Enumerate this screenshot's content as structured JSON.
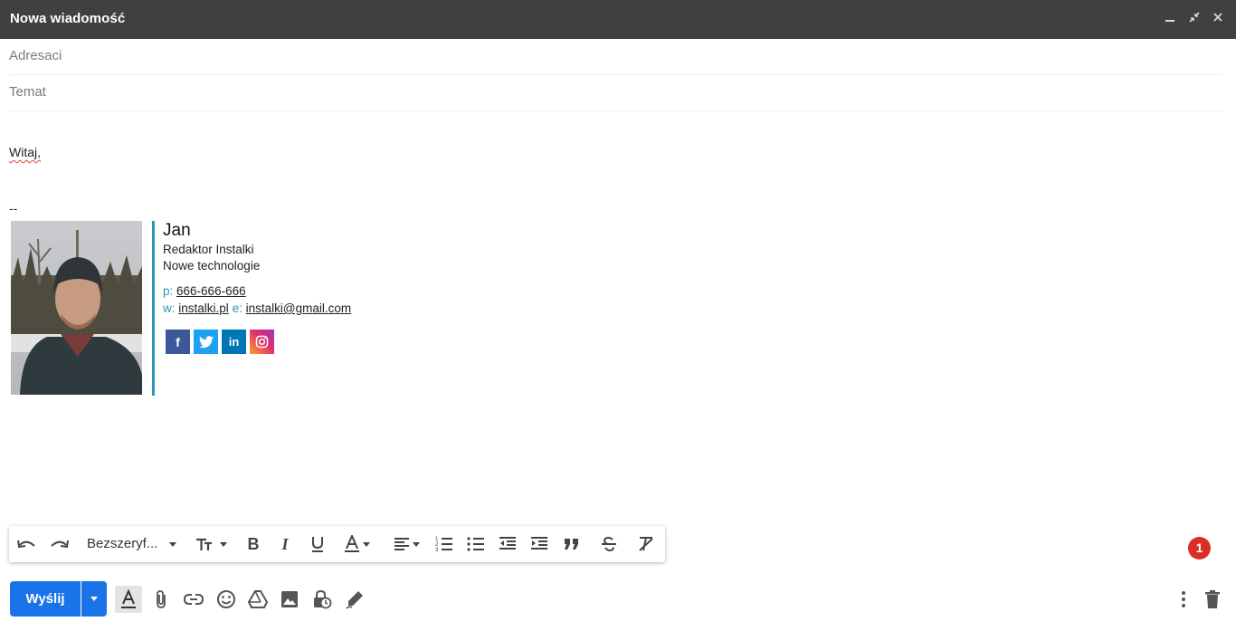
{
  "window": {
    "title": "Nowa wiadomość"
  },
  "fields": {
    "to_placeholder": "Adresaci",
    "subject_placeholder": "Temat"
  },
  "body": {
    "greeting": "Witaj,",
    "separator": "--"
  },
  "signature": {
    "name": "Jan",
    "role": "Redaktor Instalki",
    "department": "Nowe technologie",
    "phone_label": "p:",
    "phone": "666-666-666",
    "web_label": "w:",
    "web": "instalki.pl",
    "email_label": "e:",
    "email": "instalki@gmail.com",
    "accent_color": "#2c97b6",
    "social": [
      {
        "icon": "facebook-icon",
        "glyph": "f",
        "color": "#3b5998"
      },
      {
        "icon": "twitter-icon",
        "glyph": "t",
        "color": "#1da1f2"
      },
      {
        "icon": "linkedin-icon",
        "glyph": "in",
        "color": "#0077b5"
      },
      {
        "icon": "instagram-icon",
        "glyph": "◎",
        "color": "#e1306c"
      }
    ]
  },
  "format_toolbar": {
    "font": "Bezszeryf..."
  },
  "notification_badge": "1",
  "bottom_toolbar": {
    "send_label": "Wyślij",
    "primary_color": "#1a73e8"
  }
}
